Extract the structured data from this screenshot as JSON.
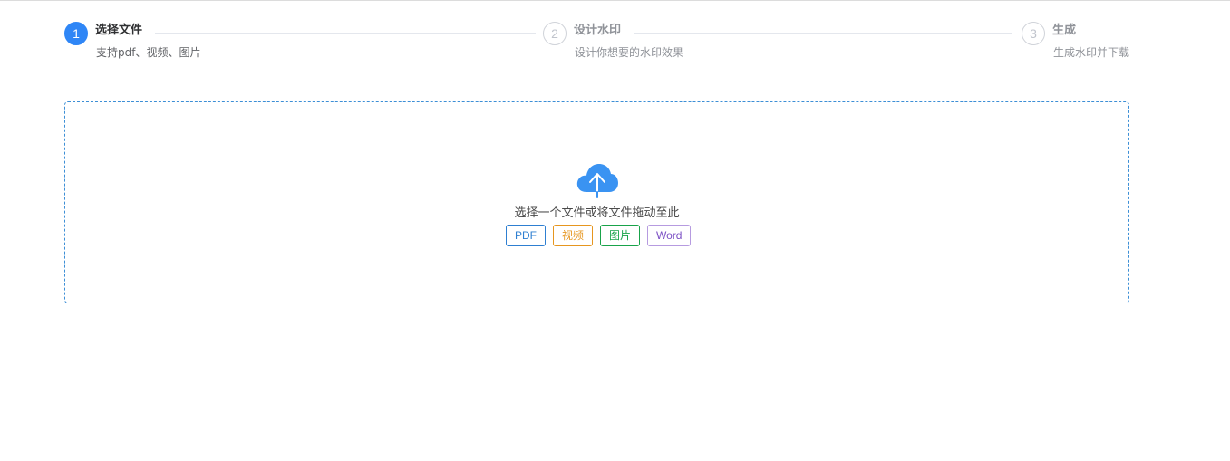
{
  "steps": [
    {
      "number": "1",
      "title": "选择文件",
      "description": "支持pdf、视频、图片",
      "status": "active"
    },
    {
      "number": "2",
      "title": "设计水印",
      "description": "设计你想要的水印效果",
      "status": "waiting"
    },
    {
      "number": "3",
      "title": "生成",
      "description": "生成水印并下载",
      "status": "waiting"
    }
  ],
  "upload": {
    "icon": "cloud-upload-icon",
    "text": "选择一个文件或将文件拖动至此",
    "file_types": [
      "PDF",
      "视频",
      "图片",
      "Word"
    ]
  },
  "colors": {
    "accent": "#2f86f6",
    "pdf": "#2e7fd1",
    "video": "#e6961f",
    "image": "#19a34a",
    "word": "#7b4fc4"
  }
}
